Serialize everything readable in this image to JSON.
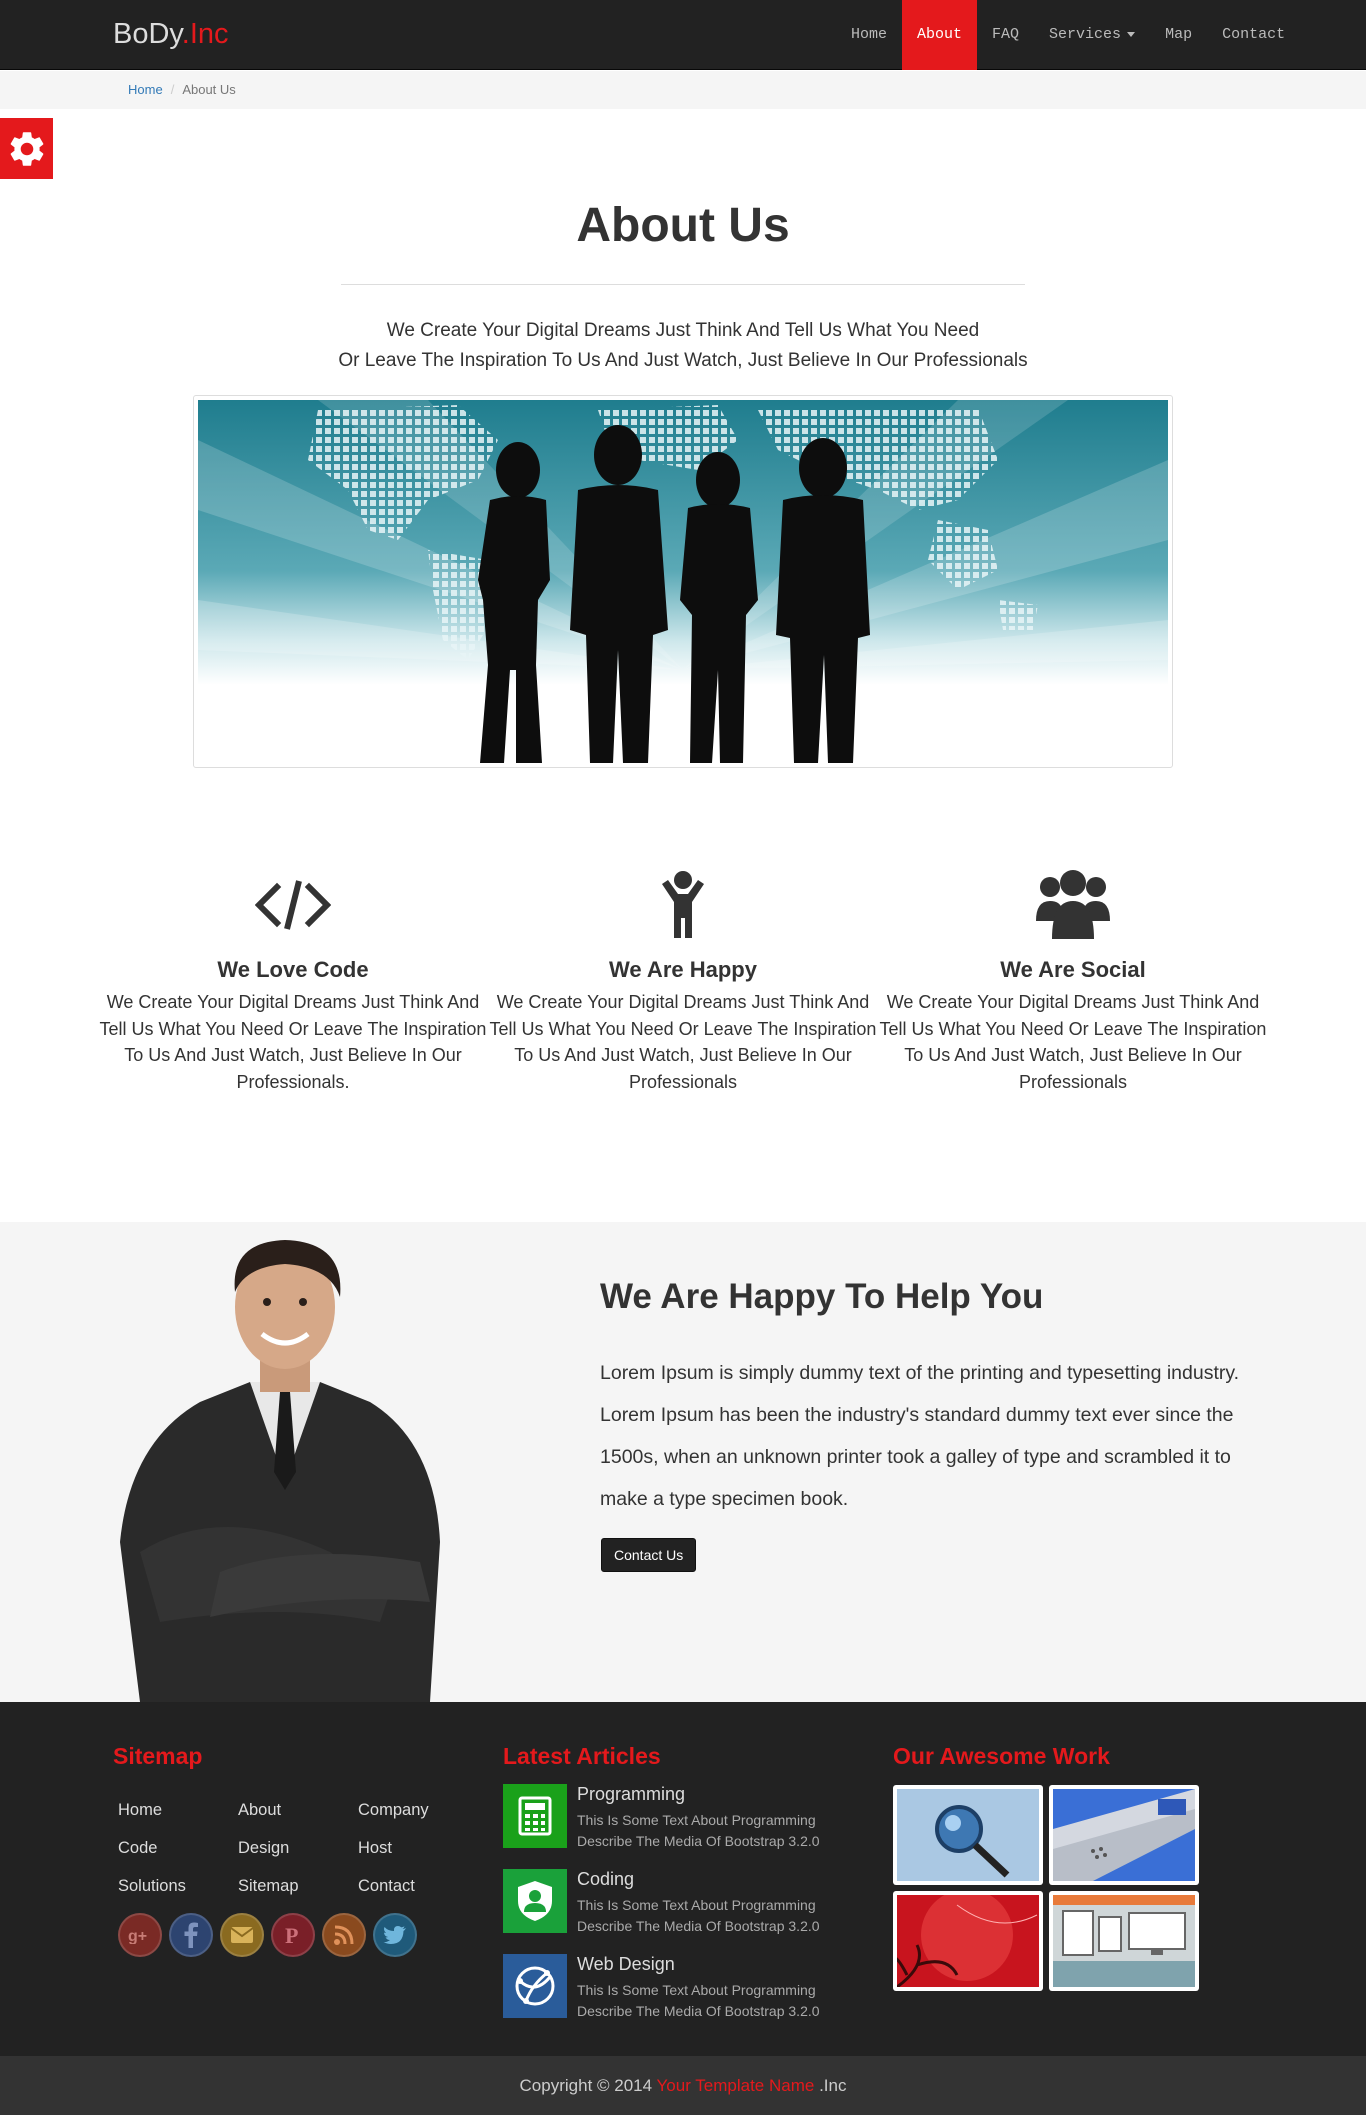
{
  "nav": {
    "brand_main": "BoDy",
    "brand_accent": ".Inc",
    "items": [
      {
        "label": "Home"
      },
      {
        "label": "About"
      },
      {
        "label": "FAQ"
      },
      {
        "label": "Services"
      },
      {
        "label": "Map"
      },
      {
        "label": "Contact"
      }
    ],
    "active": "About"
  },
  "breadcrumb": {
    "home": "Home",
    "separator": "/",
    "current": "About Us"
  },
  "about": {
    "title": "About Us",
    "intro_line1": "We Create Your Digital Dreams Just Think And Tell Us What You Need",
    "intro_line2": "Or Leave The Inspiration To Us And Just Watch, Just Believe In Our Professionals"
  },
  "features": [
    {
      "icon": "code-icon",
      "title": "We Love Code",
      "text": "We Create Your Digital Dreams Just Think And Tell Us What You Need Or Leave The Inspiration To Us And Just Watch, Just Believe In Our Professionals."
    },
    {
      "icon": "child-icon",
      "title": "We Are Happy",
      "text": "We Create Your Digital Dreams Just Think And Tell Us What You Need Or Leave The Inspiration To Us And Just Watch, Just Believe In Our Professionals"
    },
    {
      "icon": "users-icon",
      "title": "We Are Social",
      "text": "We Create Your Digital Dreams Just Think And Tell Us What You Need Or Leave The Inspiration To Us And Just Watch, Just Believe In Our Professionals"
    }
  ],
  "help": {
    "title": "We Are Happy To Help You",
    "text": "Lorem Ipsum is simply dummy text of the printing and typesetting industry. Lorem Ipsum has been the industry's standard dummy text ever since the 1500s, when an unknown printer took a galley of type and scrambled it to make a type specimen book.",
    "button": "Contact Us"
  },
  "footer": {
    "sitemap_title": "Sitemap",
    "sitemap_links": [
      "Home",
      "About",
      "Company",
      "Code",
      "Design",
      "Host",
      "Solutions",
      "Sitemap",
      "Contact"
    ],
    "social": [
      "google-plus-icon",
      "facebook-icon",
      "email-icon",
      "pinterest-icon",
      "rss-icon",
      "twitter-icon"
    ],
    "articles_title": "Latest Articles",
    "articles": [
      {
        "title": "Programming",
        "desc": "This Is Some Text About Programming Describe The Media Of Bootstrap 3.2.0",
        "icon": "calculator-icon",
        "color": "#1aa11a"
      },
      {
        "title": "Coding",
        "desc": "This Is Some Text About Programming Describe The Media Of Bootstrap 3.2.0",
        "icon": "shield-user-icon",
        "color": "#1aa13a"
      },
      {
        "title": "Web Design",
        "desc": "This Is Some Text About Programming Describe The Media Of Bootstrap 3.2.0",
        "icon": "globe-icon",
        "color": "#2a5c9a"
      }
    ],
    "work_title": "Our Awesome Work",
    "copyright_prefix": "Copyright © 2014",
    "copyright_name": "Your Template Name",
    "copyright_suffix": ".Inc"
  },
  "colors": {
    "accent": "#e4191c",
    "dark": "#222222",
    "light": "#f5f5f5"
  }
}
